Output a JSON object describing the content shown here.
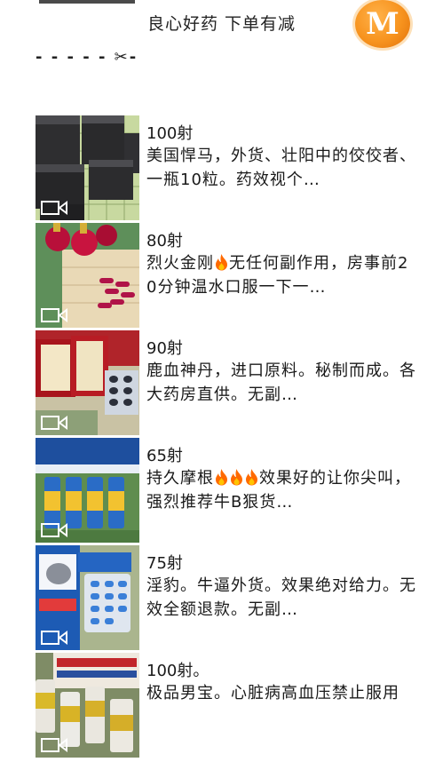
{
  "header": {
    "title": "良心好药 下单有减",
    "logo_letter": "M",
    "divider": "- - - - - ✂-"
  },
  "posts": [
    {
      "price": "100射",
      "desc": "美国悍马，外货、壮阳中的佼佼者、一瓶10粒。药效视个…"
    },
    {
      "price": "80射",
      "desc_a": "烈火金刚",
      "desc_b": "无任何副作用，房事前20分钟温水口服一下一…"
    },
    {
      "price": "90射",
      "desc": "鹿血神丹，进口原料。秘制而成。各大药房直供。无副…"
    },
    {
      "price": "65射",
      "desc_a": "持久摩根",
      "desc_b": "效果好的让你尖叫，强烈推荐牛B狠货…"
    },
    {
      "price": "75射",
      "desc": "淫豹。牛逼外货。效果绝对给力。无效全额退款。无副…"
    },
    {
      "price": "100射。",
      "desc": "极品男宝。心脏病高血压禁止服用"
    }
  ],
  "icons": {
    "video": "video-camera-icon",
    "fire": "fire-emoji-icon"
  },
  "colors": {
    "logo_orange": "#f7931e",
    "fire": "#ff6a00"
  }
}
